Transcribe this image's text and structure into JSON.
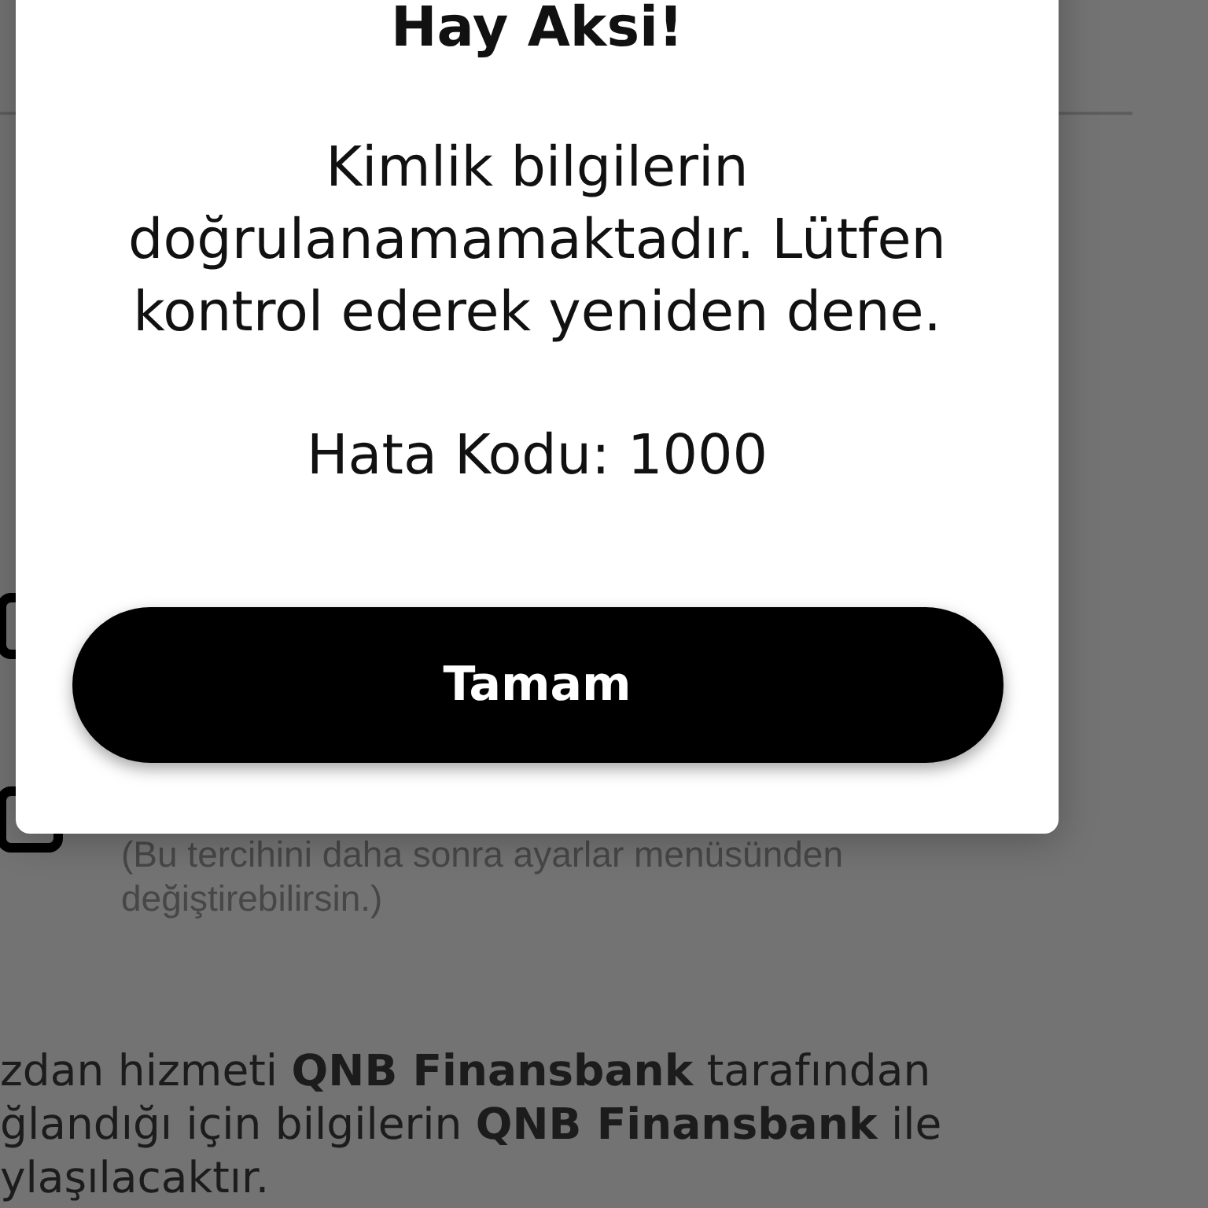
{
  "dialog": {
    "title": "Hay Aksi!",
    "message": "Kimlik bilgilerin\ndoğrulanamamaktadır. Lütfen\nkontrol ederek yeniden dene.",
    "error_code": "Hata Kodu: 1000",
    "button": "Tamam"
  },
  "background": {
    "options": [
      {
        "kind": "checkbox",
        "checked": false
      },
      {
        "kind": "checkbox",
        "checked": false,
        "note": "(Bu tercihini daha sonra ayarlar menüsünden\ndeğiştirebilirsin.)"
      }
    ],
    "info": "zdan hizmeti **QNB Finansbank** tarafından\nğlandığı için bilgilerin **QNB Finansbank** ile\nylaşılacaktır."
  }
}
